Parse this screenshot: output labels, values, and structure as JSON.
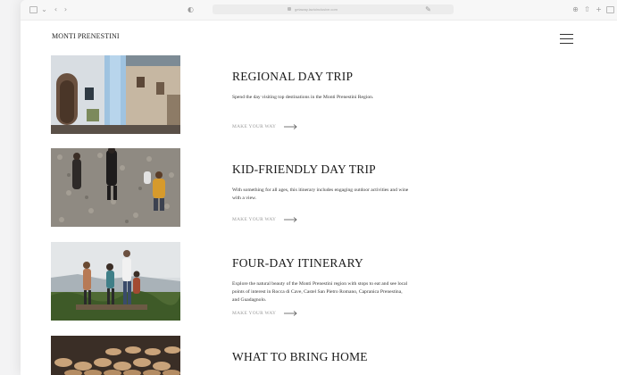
{
  "browser": {
    "url": "getaway.lazioinclusive.com"
  },
  "site": {
    "title": "MONTI PRENESTINI"
  },
  "cards": [
    {
      "heading": "REGIONAL DAY TRIP",
      "description": "Spend the day visiting top destinations in the Monti Prenestini Region.",
      "link": "MAKE YOUR WAY"
    },
    {
      "heading": "KID-FRIENDLY DAY TRIP",
      "description": "With something for all ages, this itinerary includes engaging outdoor activities and wine with a view.",
      "link": "MAKE YOUR WAY"
    },
    {
      "heading": "FOUR-DAY ITINERARY",
      "description": "Explore the natural beauty of the Monti Prenestini region with stops to eat and see local points of interest in Rocca di Cave, Castel San Pietro Romano, Capranica Prenestina, and Guadagnolo.",
      "link": "MAKE YOUR WAY"
    },
    {
      "heading": "WHAT TO BRING HOME"
    }
  ]
}
